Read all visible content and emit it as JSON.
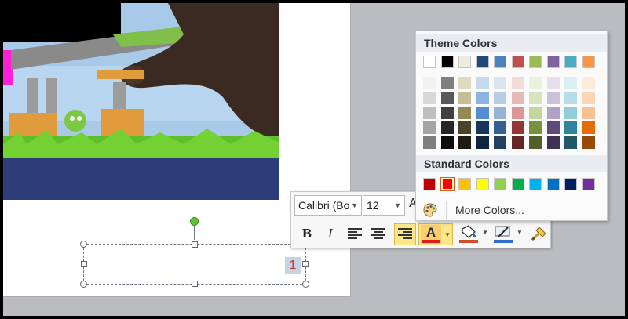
{
  "slide": {
    "page_number": "1"
  },
  "mini_toolbar": {
    "font_name": "Calibri (Bo",
    "font_size": "12",
    "grow_font_label": "A",
    "bold_label": "B",
    "italic_label": "I",
    "font_color_label": "A",
    "font_color": "#e31a1a",
    "highlight_color": "#2f6fd0",
    "fill_color": "#d64a2a"
  },
  "color_menu": {
    "theme_heading": "Theme Colors",
    "standard_heading": "Standard Colors",
    "more_colors_label": "More Colors...",
    "theme_top_row": [
      "#ffffff",
      "#000000",
      "#eeece1",
      "#1f497d",
      "#4f81bd",
      "#c0504d",
      "#9bbb59",
      "#8064a2",
      "#4bacc6",
      "#f79646"
    ],
    "theme_shades": [
      [
        "#f2f2f2",
        "#7f7f7f",
        "#ddd9c3",
        "#c6d9f0",
        "#dbe5f1",
        "#f2dcdb",
        "#ebf1dd",
        "#e5e0ec",
        "#dbeef3",
        "#fdeada"
      ],
      [
        "#d8d8d8",
        "#595959",
        "#c4bd97",
        "#8db3e2",
        "#b8cce4",
        "#e5b9b7",
        "#d7e3bc",
        "#ccc1d9",
        "#b7dde8",
        "#fbd5b5"
      ],
      [
        "#bfbfbf",
        "#3f3f3f",
        "#938953",
        "#548dd4",
        "#95b3d7",
        "#d99694",
        "#c3d69b",
        "#b2a2c7",
        "#92cddc",
        "#fac08f"
      ],
      [
        "#a5a5a5",
        "#262626",
        "#494429",
        "#17365d",
        "#366092",
        "#953734",
        "#76923c",
        "#5f497a",
        "#31859b",
        "#e36c09"
      ],
      [
        "#7f7f7f",
        "#0c0c0c",
        "#1d1b10",
        "#0f243e",
        "#244061",
        "#632423",
        "#4f6128",
        "#3f3151",
        "#205867",
        "#974806"
      ]
    ],
    "standard_colors": [
      "#c00000",
      "#ff0000",
      "#ffc000",
      "#ffff00",
      "#92d050",
      "#00b050",
      "#00b0f0",
      "#0070c0",
      "#002060",
      "#7030a0"
    ],
    "selected_standard_index": 1
  }
}
